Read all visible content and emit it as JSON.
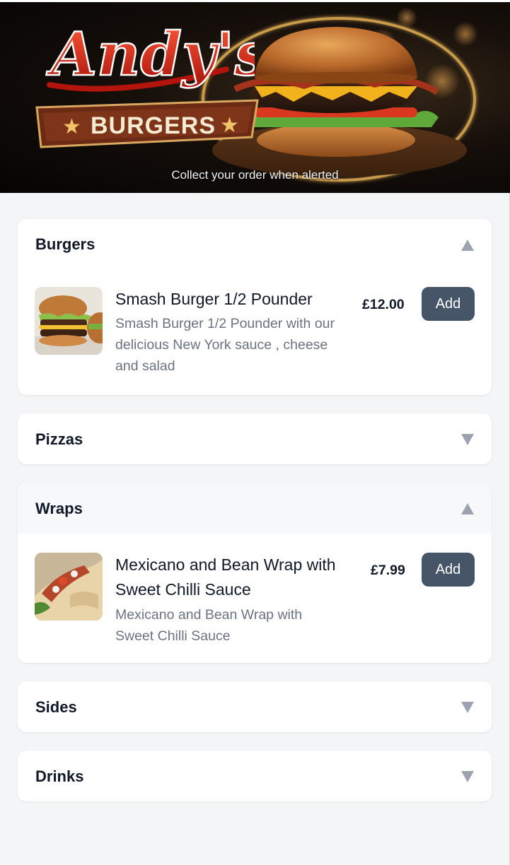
{
  "header": {
    "brand_script": "Andy's",
    "brand_ribbon": "BURGERS",
    "tagline": "Collect your order when alerted"
  },
  "categories": [
    {
      "title": "Burgers",
      "expanded": true,
      "items": [
        {
          "name": "Smash Burger 1/2 Pounder",
          "description": "Smash Burger 1/2 Pounder with our delicious New York sauce , cheese and salad",
          "price": "£12.00",
          "add_label": "Add",
          "image_icon": "burger-photo"
        }
      ]
    },
    {
      "title": "Pizzas",
      "expanded": false
    },
    {
      "title": "Wraps",
      "expanded": true,
      "items": [
        {
          "name": "Mexicano and Bean Wrap with Sweet Chilli Sauce",
          "description": "Mexicano and Bean Wrap with Sweet Chilli Sauce",
          "price": "£7.99",
          "add_label": "Add",
          "image_icon": "wrap-photo"
        }
      ]
    },
    {
      "title": "Sides",
      "expanded": false
    },
    {
      "title": "Drinks",
      "expanded": false
    }
  ],
  "colors": {
    "page_bg": "#f4f5f7",
    "card_bg": "#ffffff",
    "button_bg": "#475569",
    "muted_text": "#6b7280",
    "chevron": "#9ca3af"
  }
}
